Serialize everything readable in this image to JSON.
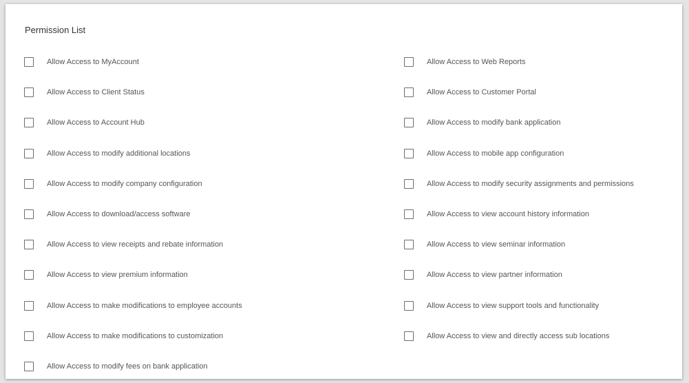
{
  "permission_list": {
    "title": "Permission List",
    "left_column": [
      {
        "label": "Allow Access to MyAccount",
        "checked": false
      },
      {
        "label": "Allow Access to Client Status",
        "checked": false
      },
      {
        "label": "Allow Access to Account Hub",
        "checked": false
      },
      {
        "label": "Allow Access to modify additional locations",
        "checked": false
      },
      {
        "label": "Allow Access to modify company configuration",
        "checked": false
      },
      {
        "label": "Allow Access to download/access software",
        "checked": false
      },
      {
        "label": "Allow Access to view receipts and rebate information",
        "checked": false
      },
      {
        "label": "Allow Access to view premium information",
        "checked": false
      },
      {
        "label": "Allow Access to make modifications to employee accounts",
        "checked": false
      },
      {
        "label": "Allow Access to make modifications to customization",
        "checked": false
      },
      {
        "label": "Allow Access to modify fees on bank application",
        "checked": false
      }
    ],
    "right_column": [
      {
        "label": "Allow Access to Web Reports",
        "checked": false
      },
      {
        "label": "Allow Access to Customer Portal",
        "checked": false
      },
      {
        "label": "Allow Access to modify bank application",
        "checked": false
      },
      {
        "label": "Allow Access to mobile app configuration",
        "checked": false
      },
      {
        "label": "Allow Access to modify security assignments and permissions",
        "checked": false
      },
      {
        "label": "Allow Access to view account history information",
        "checked": false
      },
      {
        "label": "Allow Access to view seminar information",
        "checked": false
      },
      {
        "label": "Allow Access to view partner information",
        "checked": false
      },
      {
        "label": "Allow Access to view support tools and functionality",
        "checked": false
      },
      {
        "label": "Allow Access to view and directly access sub locations",
        "checked": false
      }
    ]
  }
}
